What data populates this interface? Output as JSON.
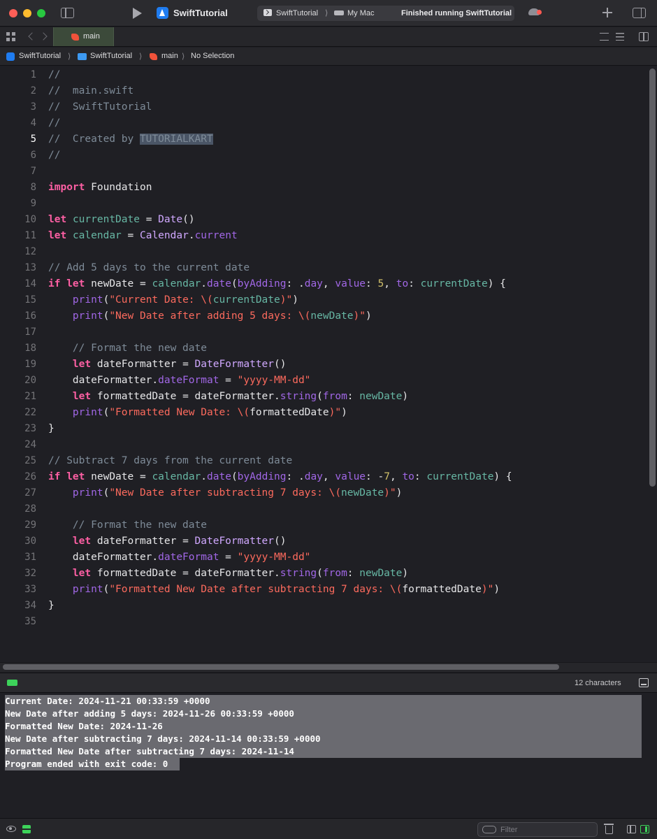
{
  "toolbar": {
    "app_title": "SwiftTutorial",
    "scheme": "SwiftTutorial",
    "scheme_separator": "⟩",
    "destination": "My Mac",
    "status": "Finished running SwiftTutorial"
  },
  "tabs": [
    {
      "label": "main",
      "icon": "swift-icon",
      "active": true
    }
  ],
  "breadcrumb": {
    "project": "SwiftTutorial",
    "folder": "SwiftTutorial",
    "file": "main",
    "symbol": "No Selection",
    "separator": "⟩"
  },
  "editor": {
    "current_line": 5,
    "lines": [
      {
        "n": "1",
        "tokens": [
          {
            "t": "//",
            "c": "cm"
          }
        ]
      },
      {
        "n": "2",
        "tokens": [
          {
            "t": "//  main.swift",
            "c": "cm"
          }
        ]
      },
      {
        "n": "3",
        "tokens": [
          {
            "t": "//  SwiftTutorial",
            "c": "cm"
          }
        ]
      },
      {
        "n": "4",
        "tokens": [
          {
            "t": "//",
            "c": "cm"
          }
        ]
      },
      {
        "n": "5",
        "tokens": [
          {
            "t": "//  Created by ",
            "c": "cm"
          },
          {
            "t": "TUTORIALKART",
            "c": "sel"
          }
        ]
      },
      {
        "n": "6",
        "tokens": [
          {
            "t": "//",
            "c": "cm"
          }
        ]
      },
      {
        "n": "7",
        "tokens": []
      },
      {
        "n": "8",
        "tokens": [
          {
            "t": "import",
            "c": "kw"
          },
          {
            "t": " Foundation",
            "c": "pl"
          }
        ]
      },
      {
        "n": "9",
        "tokens": []
      },
      {
        "n": "10",
        "tokens": [
          {
            "t": "let",
            "c": "kw"
          },
          {
            "t": " ",
            "c": "pl"
          },
          {
            "t": "currentDate",
            "c": "vr"
          },
          {
            "t": " = ",
            "c": "pl"
          },
          {
            "t": "Date",
            "c": "tn"
          },
          {
            "t": "()",
            "c": "pl"
          }
        ]
      },
      {
        "n": "11",
        "tokens": [
          {
            "t": "let",
            "c": "kw"
          },
          {
            "t": " ",
            "c": "pl"
          },
          {
            "t": "calendar",
            "c": "vr"
          },
          {
            "t": " = ",
            "c": "pl"
          },
          {
            "t": "Calendar",
            "c": "tn"
          },
          {
            "t": ".",
            "c": "pl"
          },
          {
            "t": "current",
            "c": "pr"
          }
        ]
      },
      {
        "n": "12",
        "tokens": []
      },
      {
        "n": "13",
        "tokens": [
          {
            "t": "// Add 5 days to the current date",
            "c": "cm"
          }
        ]
      },
      {
        "n": "14",
        "tokens": [
          {
            "t": "if",
            "c": "kw"
          },
          {
            "t": " ",
            "c": "pl"
          },
          {
            "t": "let",
            "c": "kw"
          },
          {
            "t": " newDate = ",
            "c": "pl"
          },
          {
            "t": "calendar",
            "c": "vr"
          },
          {
            "t": ".",
            "c": "pl"
          },
          {
            "t": "date",
            "c": "pr"
          },
          {
            "t": "(",
            "c": "pl"
          },
          {
            "t": "byAdding",
            "c": "pr"
          },
          {
            "t": ": .",
            "c": "pl"
          },
          {
            "t": "day",
            "c": "pr"
          },
          {
            "t": ", ",
            "c": "pl"
          },
          {
            "t": "value",
            "c": "pr"
          },
          {
            "t": ": ",
            "c": "pl"
          },
          {
            "t": "5",
            "c": "nm"
          },
          {
            "t": ", ",
            "c": "pl"
          },
          {
            "t": "to",
            "c": "pr"
          },
          {
            "t": ": ",
            "c": "pl"
          },
          {
            "t": "currentDate",
            "c": "vr"
          },
          {
            "t": ") {",
            "c": "pl"
          }
        ]
      },
      {
        "n": "15",
        "tokens": [
          {
            "t": "    ",
            "c": "pl"
          },
          {
            "t": "print",
            "c": "pr"
          },
          {
            "t": "(",
            "c": "pl"
          },
          {
            "t": "\"Current Date: \\(",
            "c": "st"
          },
          {
            "t": "currentDate",
            "c": "vr"
          },
          {
            "t": ")\"",
            "c": "st"
          },
          {
            "t": ")",
            "c": "pl"
          }
        ]
      },
      {
        "n": "16",
        "tokens": [
          {
            "t": "    ",
            "c": "pl"
          },
          {
            "t": "print",
            "c": "pr"
          },
          {
            "t": "(",
            "c": "pl"
          },
          {
            "t": "\"New Date after adding 5 days: \\(",
            "c": "st"
          },
          {
            "t": "newDate",
            "c": "vr"
          },
          {
            "t": ")\"",
            "c": "st"
          },
          {
            "t": ")",
            "c": "pl"
          }
        ]
      },
      {
        "n": "17",
        "tokens": []
      },
      {
        "n": "18",
        "tokens": [
          {
            "t": "    ",
            "c": "pl"
          },
          {
            "t": "// Format the new date",
            "c": "cm"
          }
        ]
      },
      {
        "n": "19",
        "tokens": [
          {
            "t": "    ",
            "c": "pl"
          },
          {
            "t": "let",
            "c": "kw"
          },
          {
            "t": " dateFormatter = ",
            "c": "pl"
          },
          {
            "t": "DateFormatter",
            "c": "tn"
          },
          {
            "t": "()",
            "c": "pl"
          }
        ]
      },
      {
        "n": "20",
        "tokens": [
          {
            "t": "    dateFormatter.",
            "c": "pl"
          },
          {
            "t": "dateFormat",
            "c": "pr"
          },
          {
            "t": " = ",
            "c": "pl"
          },
          {
            "t": "\"yyyy-MM-dd\"",
            "c": "st"
          }
        ]
      },
      {
        "n": "21",
        "tokens": [
          {
            "t": "    ",
            "c": "pl"
          },
          {
            "t": "let",
            "c": "kw"
          },
          {
            "t": " formattedDate = dateFormatter.",
            "c": "pl"
          },
          {
            "t": "string",
            "c": "pr"
          },
          {
            "t": "(",
            "c": "pl"
          },
          {
            "t": "from",
            "c": "pr"
          },
          {
            "t": ": ",
            "c": "pl"
          },
          {
            "t": "newDate",
            "c": "vr"
          },
          {
            "t": ")",
            "c": "pl"
          }
        ]
      },
      {
        "n": "22",
        "tokens": [
          {
            "t": "    ",
            "c": "pl"
          },
          {
            "t": "print",
            "c": "pr"
          },
          {
            "t": "(",
            "c": "pl"
          },
          {
            "t": "\"Formatted New Date: \\(",
            "c": "st"
          },
          {
            "t": "formattedDate",
            "c": "pl"
          },
          {
            "t": ")\"",
            "c": "st"
          },
          {
            "t": ")",
            "c": "pl"
          }
        ]
      },
      {
        "n": "23",
        "tokens": [
          {
            "t": "}",
            "c": "pl"
          }
        ]
      },
      {
        "n": "24",
        "tokens": []
      },
      {
        "n": "25",
        "tokens": [
          {
            "t": "// Subtract 7 days from the current date",
            "c": "cm"
          }
        ]
      },
      {
        "n": "26",
        "tokens": [
          {
            "t": "if",
            "c": "kw"
          },
          {
            "t": " ",
            "c": "pl"
          },
          {
            "t": "let",
            "c": "kw"
          },
          {
            "t": " newDate = ",
            "c": "pl"
          },
          {
            "t": "calendar",
            "c": "vr"
          },
          {
            "t": ".",
            "c": "pl"
          },
          {
            "t": "date",
            "c": "pr"
          },
          {
            "t": "(",
            "c": "pl"
          },
          {
            "t": "byAdding",
            "c": "pr"
          },
          {
            "t": ": .",
            "c": "pl"
          },
          {
            "t": "day",
            "c": "pr"
          },
          {
            "t": ", ",
            "c": "pl"
          },
          {
            "t": "value",
            "c": "pr"
          },
          {
            "t": ": -",
            "c": "pl"
          },
          {
            "t": "7",
            "c": "nm"
          },
          {
            "t": ", ",
            "c": "pl"
          },
          {
            "t": "to",
            "c": "pr"
          },
          {
            "t": ": ",
            "c": "pl"
          },
          {
            "t": "currentDate",
            "c": "vr"
          },
          {
            "t": ") {",
            "c": "pl"
          }
        ]
      },
      {
        "n": "27",
        "tokens": [
          {
            "t": "    ",
            "c": "pl"
          },
          {
            "t": "print",
            "c": "pr"
          },
          {
            "t": "(",
            "c": "pl"
          },
          {
            "t": "\"New Date after subtracting 7 days: \\(",
            "c": "st"
          },
          {
            "t": "newDate",
            "c": "vr"
          },
          {
            "t": ")\"",
            "c": "st"
          },
          {
            "t": ")",
            "c": "pl"
          }
        ]
      },
      {
        "n": "28",
        "tokens": []
      },
      {
        "n": "29",
        "tokens": [
          {
            "t": "    ",
            "c": "pl"
          },
          {
            "t": "// Format the new date",
            "c": "cm"
          }
        ]
      },
      {
        "n": "30",
        "tokens": [
          {
            "t": "    ",
            "c": "pl"
          },
          {
            "t": "let",
            "c": "kw"
          },
          {
            "t": " dateFormatter = ",
            "c": "pl"
          },
          {
            "t": "DateFormatter",
            "c": "tn"
          },
          {
            "t": "()",
            "c": "pl"
          }
        ]
      },
      {
        "n": "31",
        "tokens": [
          {
            "t": "    dateFormatter.",
            "c": "pl"
          },
          {
            "t": "dateFormat",
            "c": "pr"
          },
          {
            "t": " = ",
            "c": "pl"
          },
          {
            "t": "\"yyyy-MM-dd\"",
            "c": "st"
          }
        ]
      },
      {
        "n": "32",
        "tokens": [
          {
            "t": "    ",
            "c": "pl"
          },
          {
            "t": "let",
            "c": "kw"
          },
          {
            "t": " formattedDate = dateFormatter.",
            "c": "pl"
          },
          {
            "t": "string",
            "c": "pr"
          },
          {
            "t": "(",
            "c": "pl"
          },
          {
            "t": "from",
            "c": "pr"
          },
          {
            "t": ": ",
            "c": "pl"
          },
          {
            "t": "newDate",
            "c": "vr"
          },
          {
            "t": ")",
            "c": "pl"
          }
        ]
      },
      {
        "n": "33",
        "tokens": [
          {
            "t": "    ",
            "c": "pl"
          },
          {
            "t": "print",
            "c": "pr"
          },
          {
            "t": "(",
            "c": "pl"
          },
          {
            "t": "\"Formatted New Date after subtracting 7 days: \\(",
            "c": "st"
          },
          {
            "t": "formattedDate",
            "c": "pl"
          },
          {
            "t": ")\"",
            "c": "st"
          },
          {
            "t": ")",
            "c": "pl"
          }
        ]
      },
      {
        "n": "34",
        "tokens": [
          {
            "t": "}",
            "c": "pl"
          }
        ]
      },
      {
        "n": "35",
        "tokens": []
      }
    ]
  },
  "debug": {
    "char_count": "12 characters",
    "output": [
      "Current Date: 2024-11-21 00:33:59 +0000",
      "New Date after adding 5 days: 2024-11-26 00:33:59 +0000",
      "Formatted New Date: 2024-11-26",
      "New Date after subtracting 7 days: 2024-11-14 00:33:59 +0000",
      "Formatted New Date after subtracting 7 days: 2024-11-14",
      "Program ended with exit code: 0"
    ],
    "filter_placeholder": "Filter"
  },
  "colors": {
    "keyword": "#fc5fa3",
    "type": "#d0a8ff",
    "variable": "#67b7a4",
    "property": "#a167e6",
    "string": "#fc6a5d",
    "number": "#d0bf69",
    "comment": "#7e8b98",
    "accent_green": "#3dd35a"
  }
}
